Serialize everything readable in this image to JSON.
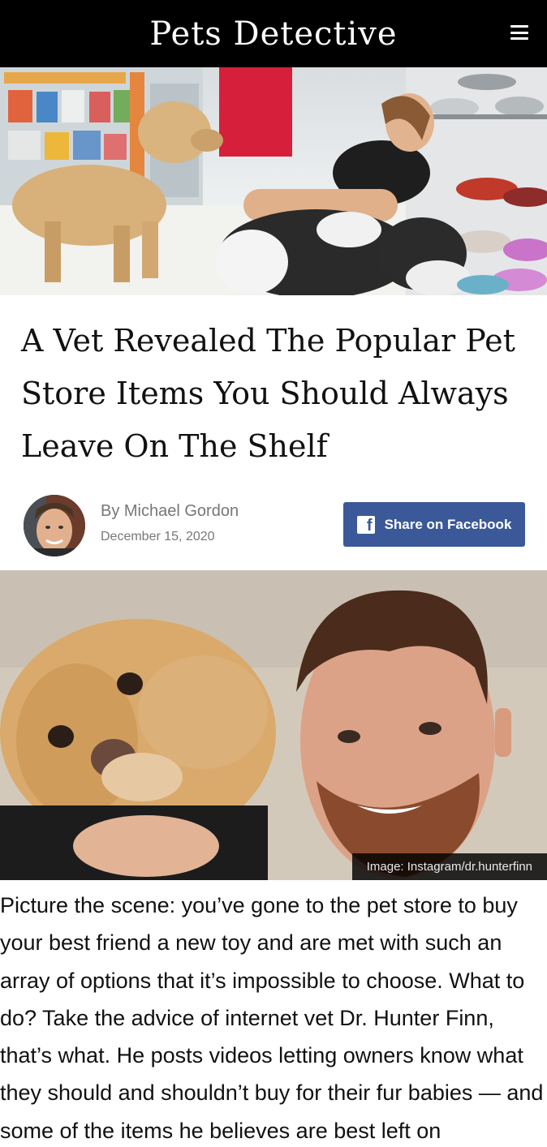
{
  "header": {
    "logo_text": "Pets Detective",
    "menu_icon": "hamburger-menu-icon",
    "background": "#000000"
  },
  "hero": {
    "alt": ""
  },
  "article": {
    "title": "A Vet Revealed The Popular Pet Store Items You Should Always Leave On The Shelf",
    "byline": "By Michael Gordon",
    "date": "December 15, 2020",
    "share_label": "Share on Facebook",
    "share_color": "#3b5998",
    "image_credit": "Image: Instagram/dr.hunterfinn",
    "body": "Picture the scene: you’ve gone to the pet store to buy your best friend a new toy and are met with such an array of options that it’s impossible to choose. What to do? Take the advice of internet vet Dr. Hunter Finn, that’s what. He posts videos letting owners know what they should and shouldn’t buy for their fur babies — and some of the items he believes are best left on"
  }
}
